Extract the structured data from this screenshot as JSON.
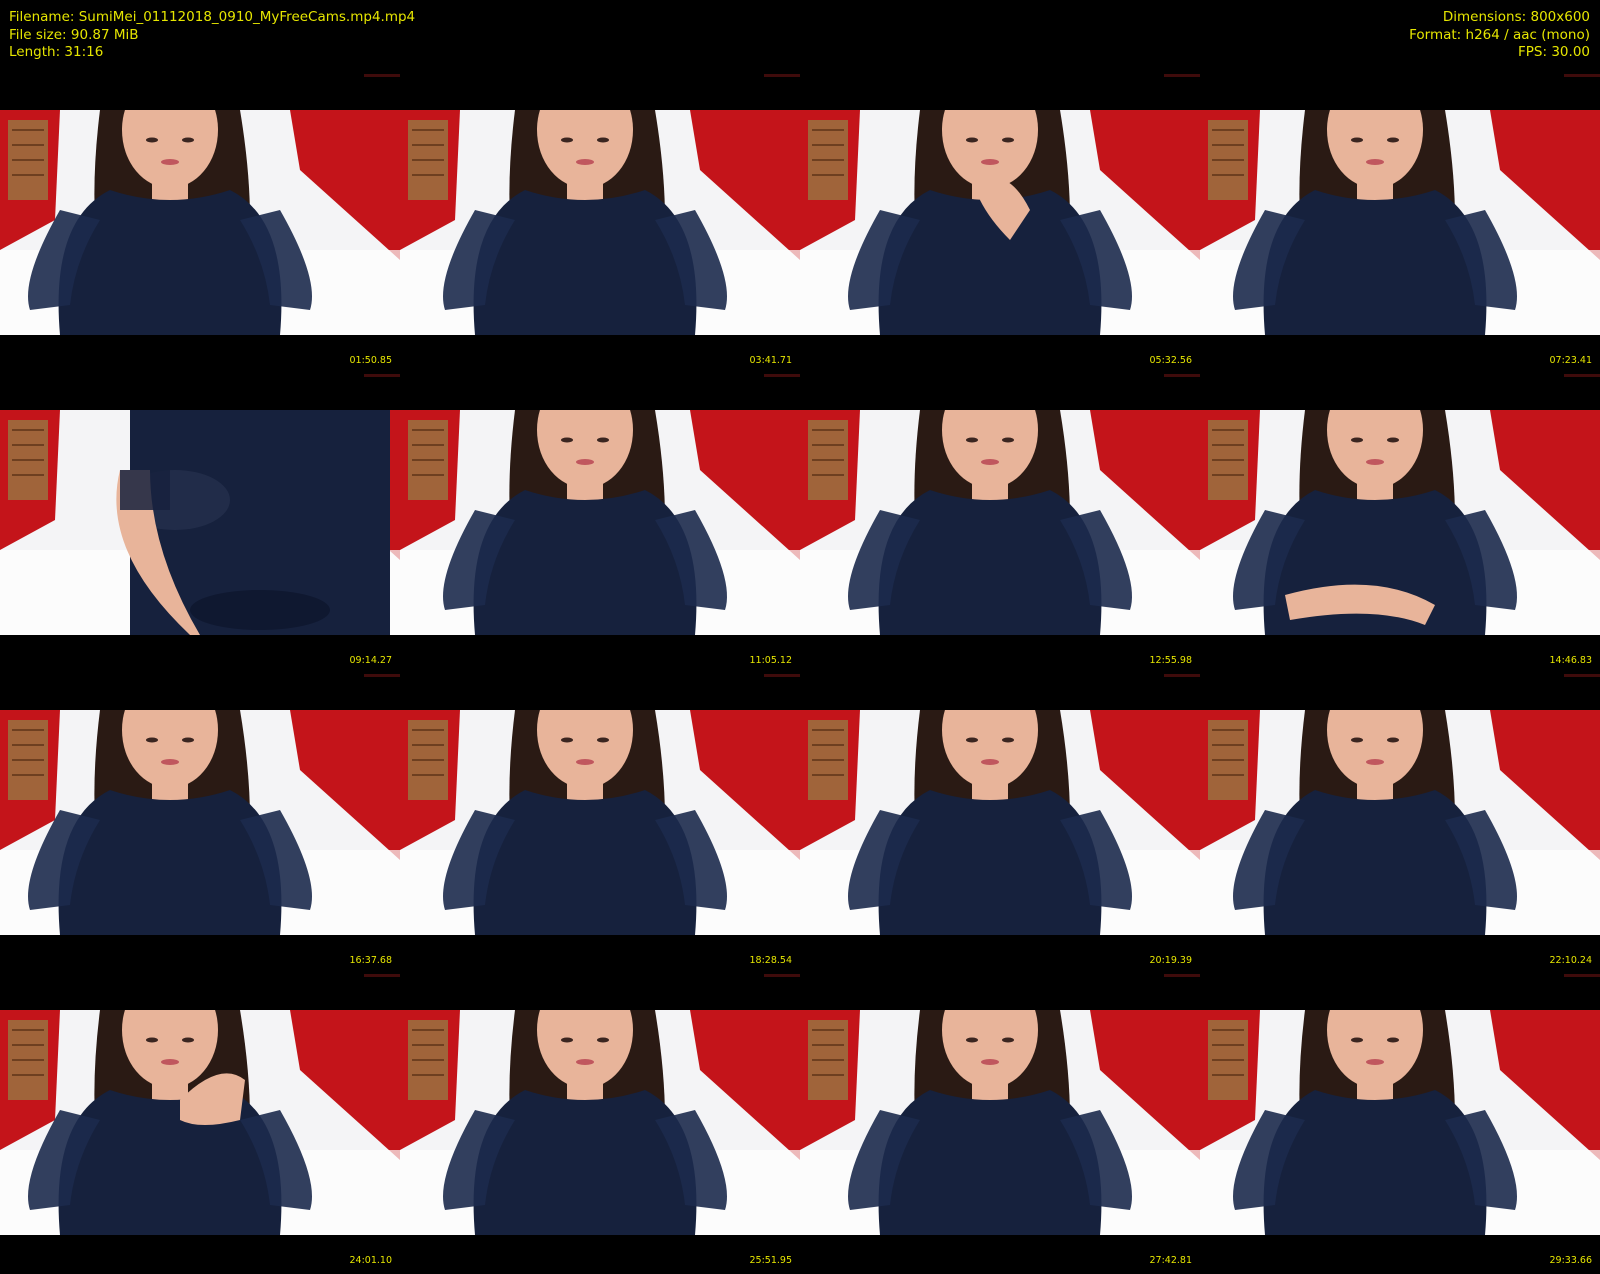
{
  "info": {
    "filename": "Filename: SumiMei_01112018_0910_MyFreeCams.mp4.mp4",
    "filesize": "File size: 90.87 MiB",
    "length": "Length: 31:16",
    "dimensions": "Dimensions: 800x600",
    "format": "Format: h264 / aac (mono)",
    "fps": "FPS: 30.00"
  },
  "colors": {
    "text": "#e6e600",
    "background": "#000000",
    "wall": "#c4141a",
    "outfit": "#16213d"
  },
  "thumbnails": [
    {
      "timestamp": "01:50.85",
      "pose": "standard"
    },
    {
      "timestamp": "03:41.71",
      "pose": "look-down"
    },
    {
      "timestamp": "05:32.56",
      "pose": "hand-chin"
    },
    {
      "timestamp": "07:23.41",
      "pose": "standard"
    },
    {
      "timestamp": "09:14.27",
      "pose": "close-body"
    },
    {
      "timestamp": "11:05.12",
      "pose": "lean"
    },
    {
      "timestamp": "12:55.98",
      "pose": "standard"
    },
    {
      "timestamp": "14:46.83",
      "pose": "arms-crossed"
    },
    {
      "timestamp": "16:37.68",
      "pose": "standard"
    },
    {
      "timestamp": "18:28.54",
      "pose": "standard"
    },
    {
      "timestamp": "20:19.39",
      "pose": "standard"
    },
    {
      "timestamp": "22:10.24",
      "pose": "standard"
    },
    {
      "timestamp": "24:01.10",
      "pose": "hand-shoulder"
    },
    {
      "timestamp": "25:51.95",
      "pose": "standard"
    },
    {
      "timestamp": "27:42.81",
      "pose": "standard"
    },
    {
      "timestamp": "29:33.66",
      "pose": "standard"
    }
  ]
}
